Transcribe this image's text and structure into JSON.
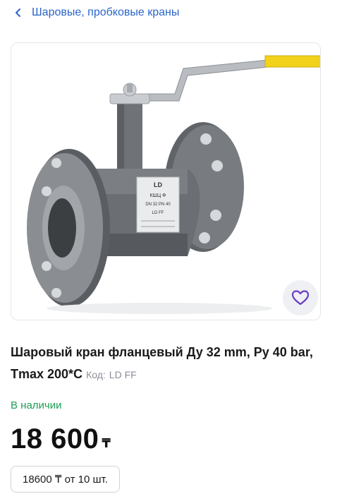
{
  "header": {
    "back_icon": "chevron-left-icon",
    "breadcrumb": "Шаровые, пробковые краны"
  },
  "product": {
    "image_alt": "Шаровый кран фланцевый",
    "plate_text": [
      "LD",
      "КШЦ Ф",
      "DN 32 PN 40",
      "LD FF"
    ],
    "favorite_icon": "heart-icon",
    "title": "Шаровый кран фланцевый Ду 32 mm, Ру 40 bar, Tmax 200*С",
    "code_label": "Код:",
    "code_value": "LD FF",
    "availability": "В наличии",
    "price": "18 600",
    "currency": "₸",
    "wholesale": "18600 ₸ от 10 шт."
  },
  "colors": {
    "accent": "#2a66c9",
    "in_stock": "#1f9d55",
    "heart": "#6a3bc4",
    "handle_yellow": "#f2d21a"
  }
}
